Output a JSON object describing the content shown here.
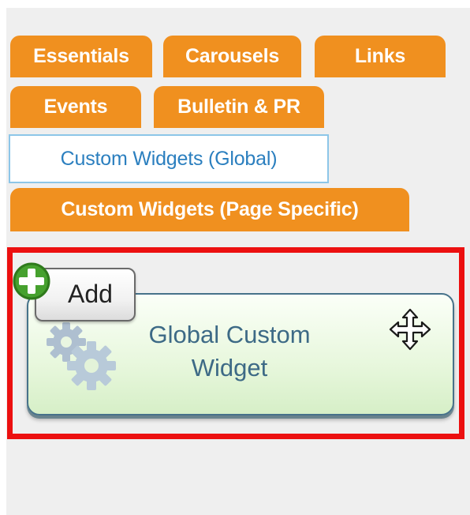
{
  "tabs": [
    {
      "id": "essentials",
      "label": "Essentials",
      "active": false
    },
    {
      "id": "carousels",
      "label": "Carousels",
      "active": false
    },
    {
      "id": "links",
      "label": "Links",
      "active": false
    },
    {
      "id": "events",
      "label": "Events",
      "active": false
    },
    {
      "id": "bulletin-pr",
      "label": "Bulletin & PR",
      "active": false
    },
    {
      "id": "custom-widgets-global",
      "label": "Custom Widgets (Global)",
      "active": true
    },
    {
      "id": "custom-widgets-page",
      "label": "Custom Widgets (Page Specific)",
      "active": false
    }
  ],
  "widget": {
    "add_label": "Add",
    "title": "Global Custom Widget",
    "icons": {
      "add": "plus-circle-icon",
      "graphic": "gears-icon",
      "move": "move-arrows-icon"
    }
  },
  "colors": {
    "tab_orange": "#f0901f",
    "tab_active_text": "#2b7fbf",
    "tab_active_border": "#8cc6e8",
    "highlight_red": "#ec1010",
    "widget_green": "#e7f7dc",
    "widget_border": "#47728a",
    "widget_text": "#3d6a86",
    "plus_green": "#46a12e",
    "gear_blue": "#aebfd0"
  }
}
